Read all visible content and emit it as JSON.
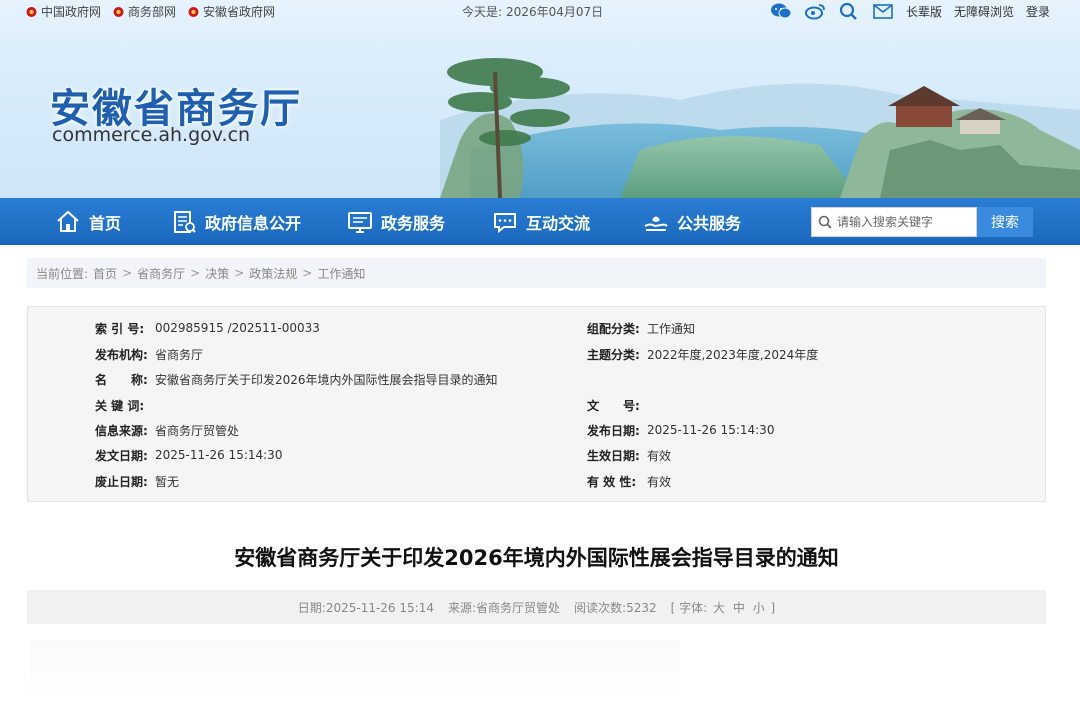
{
  "topbar": {
    "links": [
      "中国政府网",
      "商务部网",
      "安徽省政府网"
    ],
    "date_label": "今天是:",
    "date": "2026年04月07日",
    "icons": [
      "wechat-icon",
      "weibo-icon",
      "search-icon",
      "mail-icon"
    ],
    "elder": "长辈版",
    "accessible": "无障碍浏览",
    "login": "登录"
  },
  "site": {
    "title": "安徽省商务厅",
    "domain": "commerce.ah.gov.cn"
  },
  "nav": {
    "items": [
      {
        "label": "首页",
        "icon": "home-icon"
      },
      {
        "label": "政府信息公开",
        "icon": "document-icon"
      },
      {
        "label": "政务服务",
        "icon": "monitor-icon"
      },
      {
        "label": "互动交流",
        "icon": "chat-icon"
      },
      {
        "label": "公共服务",
        "icon": "service-icon"
      }
    ],
    "search_placeholder": "请输入搜索关键字",
    "search_button": "搜索"
  },
  "breadcrumb": {
    "label": "当前位置:",
    "items": [
      "首页",
      "省商务厅",
      "决策",
      "政策法规",
      "工作通知"
    ],
    "separator": ">"
  },
  "info": {
    "index_label": "索 引 号:",
    "index_value": "002985915 /202511-00033",
    "category_label": "组配分类:",
    "category_value": "工作通知",
    "publisher_label": "发布机构:",
    "publisher_value": "省商务厅",
    "topic_label": "主题分类:",
    "topic_value": "2022年度,2023年度,2024年度",
    "name_label": "名　　称:",
    "name_value": "安徽省商务厅关于印发2026年境内外国际性展会指导目录的通知",
    "keywords_label": "关 键 词:",
    "keywords_value": "",
    "docno_label": "文　　号:",
    "docno_value": "",
    "source_label": "信息来源:",
    "source_value": "省商务厅贸管处",
    "pubdate_label": "发布日期:",
    "pubdate_value": "2025-11-26 15:14:30",
    "issuedate_label": "发文日期:",
    "issuedate_value": "2025-11-26 15:14:30",
    "effective_label": "生效日期:",
    "effective_value": "有效",
    "expire_label": "废止日期:",
    "expire_value": "暂无",
    "validity_label": "有 效 性:",
    "validity_value": "有效"
  },
  "article": {
    "title": "安徽省商务厅关于印发2026年境内外国际性展会指导目录的通知",
    "date_label": "日期:",
    "date": "2025-11-26 15:14",
    "source_label": "来源:",
    "source": "省商务厅贸管处",
    "views_label": "阅读次数:",
    "views": "5232",
    "font_open": "[ 字体:",
    "font_large": "大",
    "font_medium": "中",
    "font_small": "小",
    "font_close": "]"
  },
  "colors": {
    "nav_bg": "#1f6fc8",
    "title_blue": "#1f5fae",
    "search_btn": "#3a8ae0"
  }
}
